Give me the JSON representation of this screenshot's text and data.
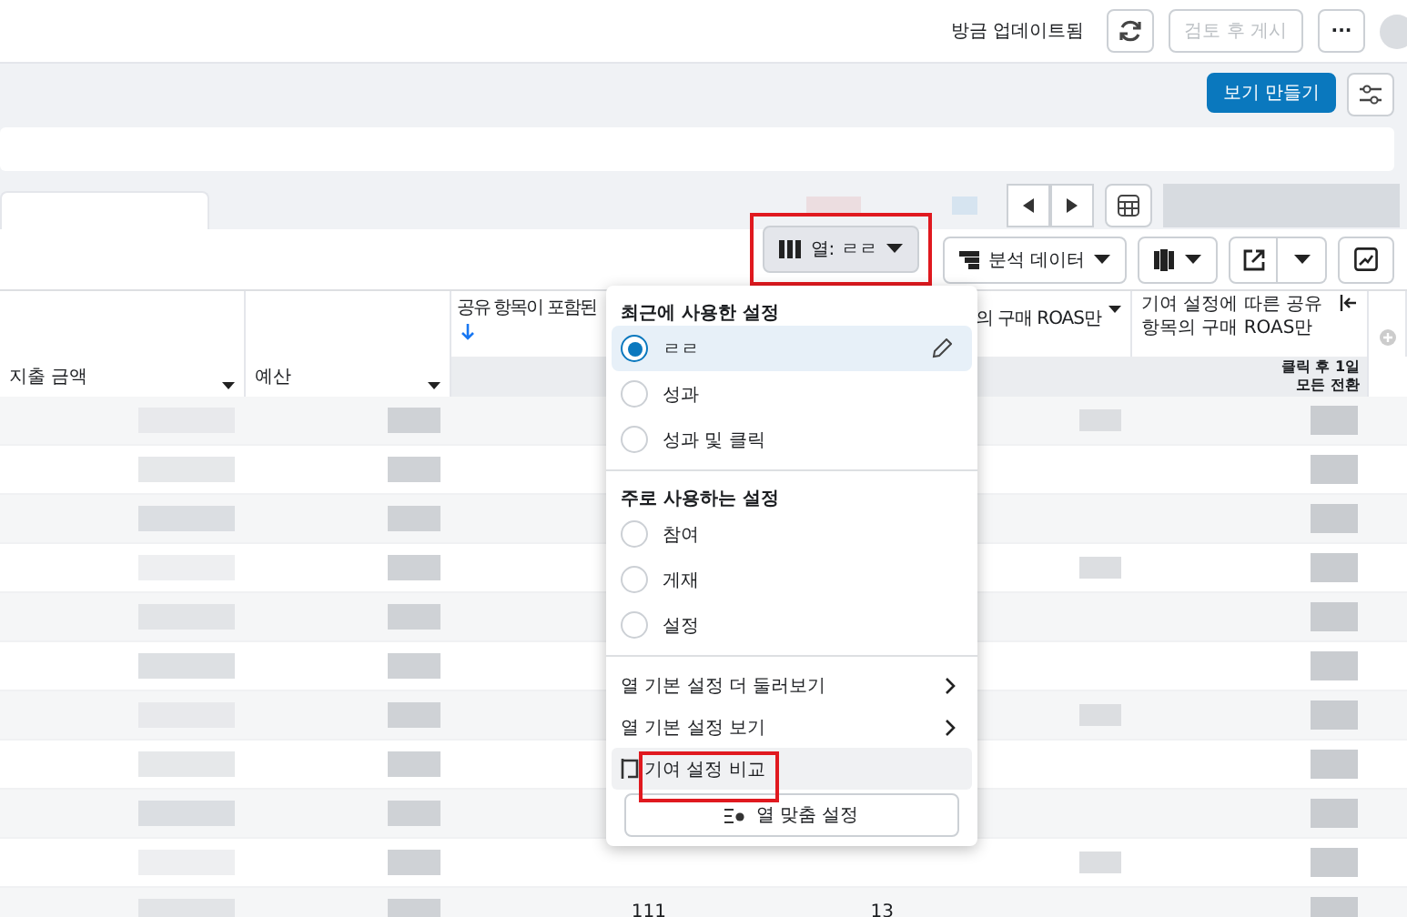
{
  "top_bar": {
    "status": "방금 업데이트됨",
    "publish_button": {
      "label": "검토 후 게시",
      "disabled": true
    },
    "more_button": "···"
  },
  "view_bar": {
    "create_view_button": "보기 만들기"
  },
  "toolbar": {
    "columns_button": "열: ㄹㄹ",
    "breakdown_button": "분석 데이터"
  },
  "table": {
    "columns": [
      {
        "label": "지출 금액",
        "kind": "sortable"
      },
      {
        "label": "예산",
        "kind": "sortable"
      },
      {
        "label": "공유 항목이 포함된",
        "kind": "sorted"
      },
      {
        "kind": "hidden"
      },
      {
        "label": "의 구매 ROAS만",
        "kind": "covered"
      },
      {
        "label": "기여 설정에 따른 공유 항목의 구매 ROAS만",
        "kind": "pinned"
      }
    ],
    "sub_header": [
      "클릭 후 1일",
      "모든 전환"
    ],
    "rows": [
      {
        "blurred": true
      },
      {
        "blurred": true
      },
      {
        "blurred": true
      },
      {
        "blurred": true
      },
      {
        "blurred": true
      },
      {
        "blurred": true
      },
      {
        "blurred": true
      },
      {
        "blurred": true
      },
      {
        "blurred": true
      },
      {
        "blurred": true
      },
      {
        "blurred": true,
        "column_3": "111",
        "column_4": "13"
      }
    ]
  },
  "menu": {
    "sections": [
      {
        "title": "최근에 사용한 설정",
        "items": [
          {
            "label": "ㄹㄹ",
            "selected": true,
            "editable": true
          },
          {
            "label": "성과",
            "selected": false,
            "editable": false
          },
          {
            "label": "성과 및 클릭",
            "selected": false,
            "editable": false
          }
        ]
      },
      {
        "title": "주로 사용하는 설정",
        "items": [
          {
            "label": "참여",
            "selected": false,
            "editable": false
          },
          {
            "label": "게재",
            "selected": false,
            "editable": false
          },
          {
            "label": "설정",
            "selected": false,
            "editable": false
          }
        ]
      }
    ],
    "links": [
      {
        "label": "열 기본 설정 더 둘러보기",
        "kind": "submenu",
        "highlighted": false
      },
      {
        "label": "열 기본 설정 보기",
        "kind": "submenu",
        "highlighted": false
      },
      {
        "label": "기여 설정 비교",
        "kind": "action",
        "highlighted": true
      }
    ],
    "customize_button": "열 맞춤 설정"
  }
}
